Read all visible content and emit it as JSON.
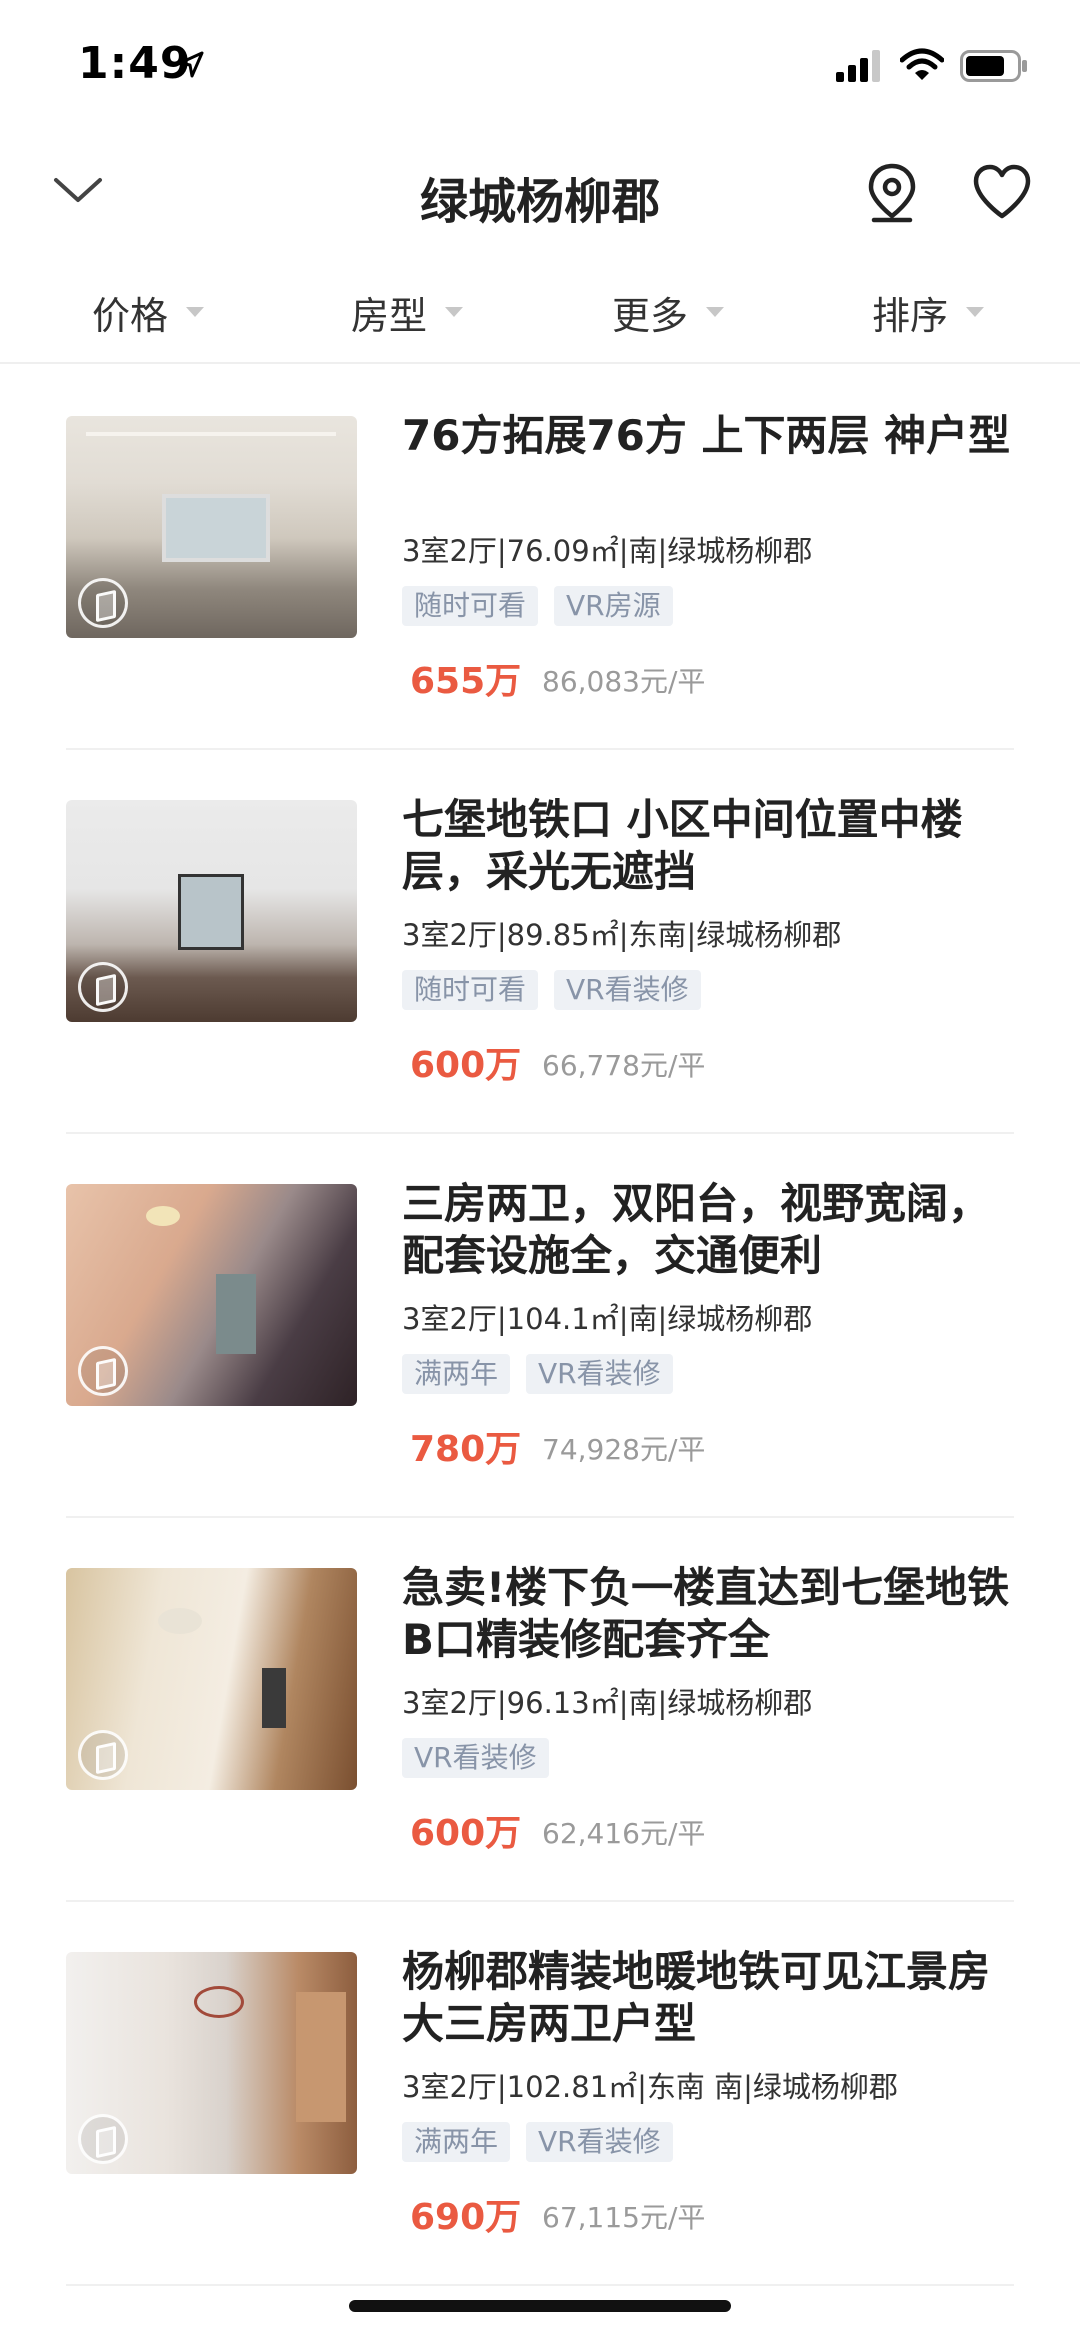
{
  "status_bar": {
    "time": "1:49"
  },
  "nav": {
    "title": "绿城杨柳郡",
    "icons": [
      "chevron-down-icon",
      "map-pin-icon",
      "heart-icon"
    ]
  },
  "filters": [
    {
      "label": "价格"
    },
    {
      "label": "房型"
    },
    {
      "label": "更多"
    },
    {
      "label": "排序"
    }
  ],
  "listings": [
    {
      "title": "76方拓展76方 上下两层 神户型",
      "meta": "3室2厅|76.09㎡|南|绿城杨柳郡",
      "tags": [
        "随时可看",
        "VR房源"
      ],
      "price": "655万",
      "unit_price": "86,083元/平"
    },
    {
      "title": "七堡地铁口 小区中间位置中楼层，采光无遮挡",
      "meta": "3室2厅|89.85㎡|东南|绿城杨柳郡",
      "tags": [
        "随时可看",
        "VR看装修"
      ],
      "price": "600万",
      "unit_price": "66,778元/平"
    },
    {
      "title": "三房两卫，双阳台，视野宽阔，配套设施全，交通便利",
      "meta": "3室2厅|104.1㎡|南|绿城杨柳郡",
      "tags": [
        "满两年",
        "VR看装修"
      ],
      "price": "780万",
      "unit_price": "74,928元/平"
    },
    {
      "title": "急卖!楼下负一楼直达到七堡地铁B口精装修配套齐全",
      "meta": "3室2厅|96.13㎡|南|绿城杨柳郡",
      "tags": [
        "VR看装修"
      ],
      "price": "600万",
      "unit_price": "62,416元/平"
    },
    {
      "title": "杨柳郡精装地暖地铁可见江景房大三房两卫户型",
      "meta": "3室2厅|102.81㎡|东南 南|绿城杨柳郡",
      "tags": [
        "满两年",
        "VR看装修"
      ],
      "price": "690万",
      "unit_price": "67,115元/平"
    }
  ],
  "colors": {
    "price": "#ea5a41",
    "tag_bg": "#eef1f5",
    "tag_text": "#8894a8"
  }
}
